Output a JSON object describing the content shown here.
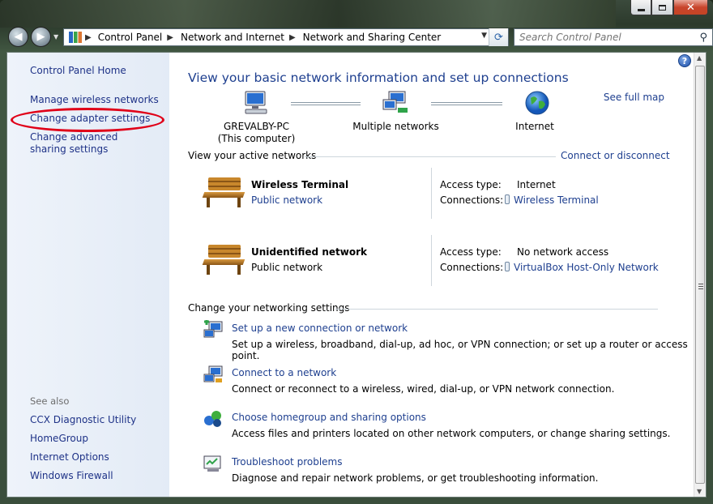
{
  "window": {
    "controls": {
      "minimize": "minimize-icon",
      "maximize": "maximize-icon",
      "close": "close-icon"
    }
  },
  "address": {
    "breadcrumbs": [
      "Control Panel",
      "Network and Internet",
      "Network and Sharing Center"
    ]
  },
  "search": {
    "placeholder": "Search Control Panel"
  },
  "sidebar": {
    "home": "Control Panel Home",
    "links": [
      "Manage wireless networks",
      "Change adapter settings",
      "Change advanced sharing settings"
    ],
    "see_also_title": "See also",
    "see_also": [
      "CCX Diagnostic Utility",
      "HomeGroup",
      "Internet Options",
      "Windows Firewall"
    ]
  },
  "main": {
    "title": "View your basic network information and set up connections",
    "see_full_map": "See full map",
    "map": {
      "computer_name": "GREVALBY-PC",
      "computer_sub": "(This computer)",
      "middle": "Multiple networks",
      "internet": "Internet"
    },
    "active_header": "View your active networks",
    "connect_link": "Connect or disconnect",
    "networks": [
      {
        "name": "Wireless Terminal",
        "type": "Public network",
        "type_is_link": true,
        "access_label": "Access type:",
        "access": "Internet",
        "conn_label": "Connections:",
        "connection": "Wireless Terminal"
      },
      {
        "name": "Unidentified network",
        "type": "Public network",
        "type_is_link": false,
        "access_label": "Access type:",
        "access": "No network access",
        "conn_label": "Connections:",
        "connection": "VirtualBox Host-Only Network"
      }
    ],
    "settings_header": "Change your networking settings",
    "tasks": [
      {
        "title": "Set up a new connection or network",
        "desc": "Set up a wireless, broadband, dial-up, ad hoc, or VPN connection; or set up a router or access point."
      },
      {
        "title": "Connect to a network",
        "desc": "Connect or reconnect to a wireless, wired, dial-up, or VPN network connection."
      },
      {
        "title": "Choose homegroup and sharing options",
        "desc": "Access files and printers located on other network computers, or change sharing settings."
      },
      {
        "title": "Troubleshoot problems",
        "desc": "Diagnose and repair network problems, or get troubleshooting information."
      }
    ]
  }
}
